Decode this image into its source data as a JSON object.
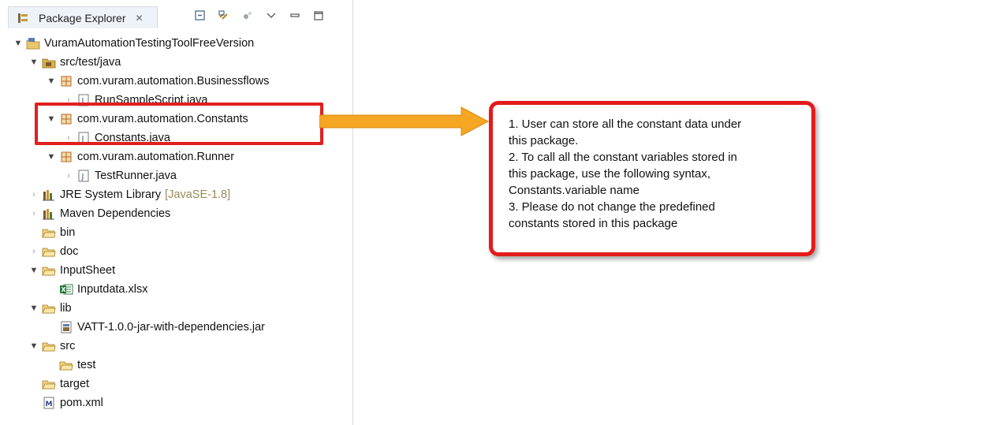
{
  "view": {
    "title": "Package Explorer",
    "close_glyph": "✕",
    "toolbar": [
      "collapse-all-icon",
      "link-with-editor-icon",
      "focus-icon",
      "view-menu-icon",
      "minimize-icon",
      "maximize-icon"
    ]
  },
  "tree": {
    "items": [
      {
        "label": "VuramAutomationTestingToolFreeVersion",
        "icon": "project-icon",
        "expanded": true
      },
      {
        "label": "src/test/java",
        "icon": "source-folder-icon",
        "expanded": true
      },
      {
        "label": "com.vuram.automation.Businessflows",
        "icon": "package-icon",
        "expanded": true
      },
      {
        "label": "RunSampleScript.java",
        "icon": "java-file-icon",
        "expanded": false
      },
      {
        "label": "com.vuram.automation.Constants",
        "icon": "package-icon",
        "expanded": true
      },
      {
        "label": "Constants.java",
        "icon": "java-file-icon",
        "expanded": false
      },
      {
        "label": "com.vuram.automation.Runner",
        "icon": "package-icon",
        "expanded": true
      },
      {
        "label": "TestRunner.java",
        "icon": "java-file-icon",
        "expanded": false
      },
      {
        "label": "JRE System Library",
        "suffix": "[JavaSE-1.8]",
        "icon": "library-icon",
        "expanded": false
      },
      {
        "label": "Maven Dependencies",
        "icon": "library-icon",
        "expanded": false
      },
      {
        "label": "bin",
        "icon": "folder-icon"
      },
      {
        "label": "doc",
        "icon": "folder-icon",
        "expanded": false
      },
      {
        "label": "InputSheet",
        "icon": "folder-icon",
        "expanded": true
      },
      {
        "label": "Inputdata.xlsx",
        "icon": "excel-file-icon"
      },
      {
        "label": "lib",
        "icon": "folder-icon",
        "expanded": true
      },
      {
        "label": "VATT-1.0.0-jar-with-dependencies.jar",
        "icon": "jar-file-icon"
      },
      {
        "label": "src",
        "icon": "folder-icon",
        "expanded": true
      },
      {
        "label": "test",
        "icon": "folder-icon"
      },
      {
        "label": "target",
        "icon": "folder-icon"
      },
      {
        "label": "pom.xml",
        "icon": "maven-pom-icon"
      }
    ]
  },
  "callout": {
    "lines": [
      "1. User can store all the constant data under",
      "this package.",
      "2. To call all the constant variables stored in",
      "this package, use the following syntax,",
      "Constants.variable name",
      "3. Please do not change the predefined",
      "constants stored in this package"
    ]
  },
  "colors": {
    "highlight": "#e0201e",
    "arrow": "#f5a623",
    "callout_border": "#e41b1b"
  }
}
